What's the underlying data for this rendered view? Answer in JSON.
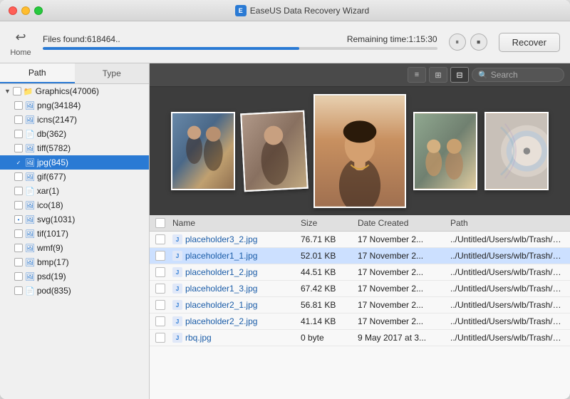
{
  "window": {
    "title": "EaseUS Data Recovery Wizard"
  },
  "topbar": {
    "files_found_label": "Files found:",
    "files_found_value": "618464..",
    "remaining_label": "Remaining time:",
    "remaining_value": "1:15:30",
    "progress_percent": 65,
    "home_label": "Home",
    "recover_label": "Recover"
  },
  "sidebar": {
    "path_tab": "Path",
    "type_tab": "Type",
    "items": [
      {
        "id": "graphics",
        "label": "Graphics(47006)",
        "indent": 0,
        "expanded": true,
        "checked": false
      },
      {
        "id": "png",
        "label": "png(34184)",
        "indent": 1,
        "checked": false
      },
      {
        "id": "icns",
        "label": "icns(2147)",
        "indent": 1,
        "checked": false
      },
      {
        "id": "db",
        "label": "db(362)",
        "indent": 1,
        "checked": false
      },
      {
        "id": "tiff1",
        "label": "tiff(5782)",
        "indent": 1,
        "checked": false
      },
      {
        "id": "jpg",
        "label": "jpg(845)",
        "indent": 1,
        "checked": true,
        "selected": true
      },
      {
        "id": "gif",
        "label": "gif(677)",
        "indent": 1,
        "checked": false
      },
      {
        "id": "xar",
        "label": "xar(1)",
        "indent": 1,
        "checked": false
      },
      {
        "id": "ico",
        "label": "ico(18)",
        "indent": 1,
        "checked": false
      },
      {
        "id": "svg",
        "label": "svg(1031)",
        "indent": 1,
        "checked": false
      },
      {
        "id": "tiff2",
        "label": "tif(1017)",
        "indent": 1,
        "checked": false
      },
      {
        "id": "wmf",
        "label": "wmf(9)",
        "indent": 1,
        "checked": false
      },
      {
        "id": "bmp",
        "label": "bmp(17)",
        "indent": 1,
        "checked": false
      },
      {
        "id": "psd",
        "label": "psd(19)",
        "indent": 1,
        "checked": false
      },
      {
        "id": "pod",
        "label": "pod(835)",
        "indent": 1,
        "checked": false
      }
    ]
  },
  "toolbar": {
    "search_placeholder": "Search",
    "view_list_icon": "≡",
    "view_grid_icon": "⊞",
    "view_thumb_icon": "⊟"
  },
  "file_list": {
    "headers": [
      "",
      "Name",
      "Size",
      "Date Created",
      "Path"
    ],
    "rows": [
      {
        "name": "placeholder3_2.jpg",
        "size": "76.71 KB",
        "date": "17 November 2...",
        "path": "../Untitled/Users/wlb/Trash/paul'..."
      },
      {
        "name": "placeholder1_1.jpg",
        "size": "52.01 KB",
        "date": "17 November 2...",
        "path": "../Untitled/Users/wlb/Trash/paul'..."
      },
      {
        "name": "placeholder1_2.jpg",
        "size": "44.51 KB",
        "date": "17 November 2...",
        "path": "../Untitled/Users/wlb/Trash/paul'..."
      },
      {
        "name": "placeholder1_3.jpg",
        "size": "67.42 KB",
        "date": "17 November 2...",
        "path": "../Untitled/Users/wlb/Trash/paul'..."
      },
      {
        "name": "placeholder2_1.jpg",
        "size": "56.81 KB",
        "date": "17 November 2...",
        "path": "../Untitled/Users/wlb/Trash/paul'..."
      },
      {
        "name": "placeholder2_2.jpg",
        "size": "41.14 KB",
        "date": "17 November 2...",
        "path": "../Untitled/Users/wlb/Trash/paul'..."
      },
      {
        "name": "rbq.jpg",
        "size": "0 byte",
        "date": "9 May 2017 at 3...",
        "path": "../Untitled/Users/wlb/Trash/paul'..."
      }
    ]
  },
  "colors": {
    "accent": "#2a7ad4",
    "selected_bg": "#2a7ad4",
    "progress_fill": "#2a7ad4"
  }
}
